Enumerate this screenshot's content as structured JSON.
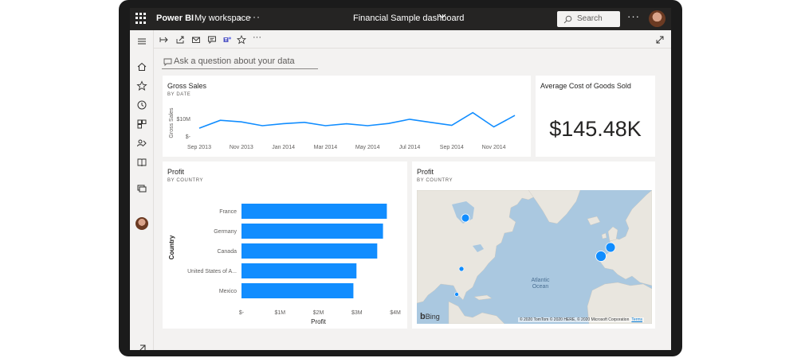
{
  "topbar": {
    "app_name": "Power BI",
    "workspace": "My workspace",
    "more": "···",
    "dashboard_title": "Financial Sample dashboard",
    "search_placeholder": "Search",
    "menu_more": "···"
  },
  "qna": {
    "placeholder": "Ask a question about your data"
  },
  "tiles": {
    "gross_sales": {
      "title": "Gross Sales",
      "subtitle": "BY DATE"
    },
    "avg_cogs": {
      "title": "Average Cost of Goods Sold",
      "value": "$145.48K"
    },
    "profit_bar": {
      "title": "Profit",
      "subtitle": "BY COUNTRY"
    },
    "profit_map": {
      "title": "Profit",
      "subtitle": "BY COUNTRY",
      "ocean_label": "Atlantic\nOcean",
      "logo": "Bing",
      "attribution": "© 2020 TomTom © 2020 HERE, © 2020 Microsoft Corporation",
      "terms": "Terms"
    }
  },
  "chart_data": [
    {
      "type": "line",
      "title": "Gross Sales",
      "subtitle": "BY DATE",
      "ylabel": "Gross Sales",
      "y_ticks": [
        "$10M",
        "$-"
      ],
      "x_ticks": [
        "Sep 2013",
        "Nov 2013",
        "Jan 2014",
        "Mar 2014",
        "May 2014",
        "Jul 2014",
        "Sep 2014",
        "Nov 2014"
      ],
      "ylim": [
        0,
        16
      ],
      "x": [
        "Sep 2013",
        "Oct 2013",
        "Nov 2013",
        "Dec 2013",
        "Jan 2014",
        "Feb 2014",
        "Mar 2014",
        "Apr 2014",
        "May 2014",
        "Jun 2014",
        "Jul 2014",
        "Aug 2014",
        "Sep 2014",
        "Oct 2014",
        "Nov 2014",
        "Dec 2014"
      ],
      "series": [
        {
          "values": [
            5.0,
            9.5,
            8.6,
            6.4,
            7.6,
            8.3,
            6.4,
            7.5,
            6.4,
            7.7,
            10.1,
            8.3,
            6.6,
            13.9,
            5.7,
            12.3
          ]
        }
      ],
      "color": "#118dff"
    },
    {
      "type": "bar",
      "orientation": "horizontal",
      "title": "Profit",
      "subtitle": "BY COUNTRY",
      "xlabel": "Profit",
      "ylabel": "Country",
      "categories": [
        "France",
        "Germany",
        "Canada",
        "United States of A...",
        "Mexico"
      ],
      "values": [
        3.78,
        3.68,
        3.53,
        2.99,
        2.91
      ],
      "x_ticks": [
        "$-",
        "$1M",
        "$2M",
        "$3M",
        "$4M"
      ],
      "xlim": [
        0,
        4
      ],
      "color": "#118dff"
    }
  ]
}
